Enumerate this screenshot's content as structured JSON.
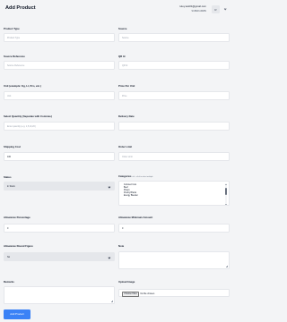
{
  "header": {
    "title": "Add Product",
    "user_email": "rutoy.test01@gmail.com",
    "user_role": "SUPER ADMIN",
    "avatar_initial": "R"
  },
  "form": {
    "product_type": {
      "label": "Product Type",
      "placeholder": "Product Type"
    },
    "source": {
      "label": "Source",
      "placeholder": "Source"
    },
    "source_reference": {
      "label": "Source Reference",
      "placeholder": "Source Reference"
    },
    "qr_id": {
      "label": "QR Id",
      "placeholder": "QR Id"
    },
    "unit": {
      "label": "Unit (example: Kg, Lt, Pcs, etc.)",
      "placeholder": "Unit"
    },
    "price_per_unit": {
      "label": "Price Per Unit",
      "placeholder": "Price"
    },
    "select_quantity": {
      "label": "Select Quantity (Separate with Commas)",
      "placeholder": "Enter quantity (e.g. 1,5,10,20)"
    },
    "delivery_date": {
      "label": "Delivery Date",
      "value": ""
    },
    "shipping_cost": {
      "label": "Shipping Cost",
      "value": "100"
    },
    "order_limit": {
      "label": "Order Limit",
      "placeholder": "Order Limit"
    },
    "status": {
      "label": "Status",
      "value": "In Stock"
    },
    "categories": {
      "label": "Categories",
      "hint": "ctrl + click to select multiple",
      "options": [
        "Cultured Cuts",
        "Beef",
        "Prawn",
        "Poultry/Plants",
        "Energy Blender"
      ]
    },
    "allowance_percentage": {
      "label": "Allowance Percentage",
      "value": "0"
    },
    "allowance_minimum_amount": {
      "label": "Allowance Minimum Amount",
      "value": "0"
    },
    "allowance_round_figure": {
      "label": "Allowance Round Figure",
      "value": "No"
    },
    "note": {
      "label": "Note"
    },
    "remarks": {
      "label": "Remarks"
    },
    "upload_image": {
      "label": "Upload Image",
      "button": "Choose Files",
      "status": "No file chosen"
    }
  },
  "submit_label": "Add Product"
}
